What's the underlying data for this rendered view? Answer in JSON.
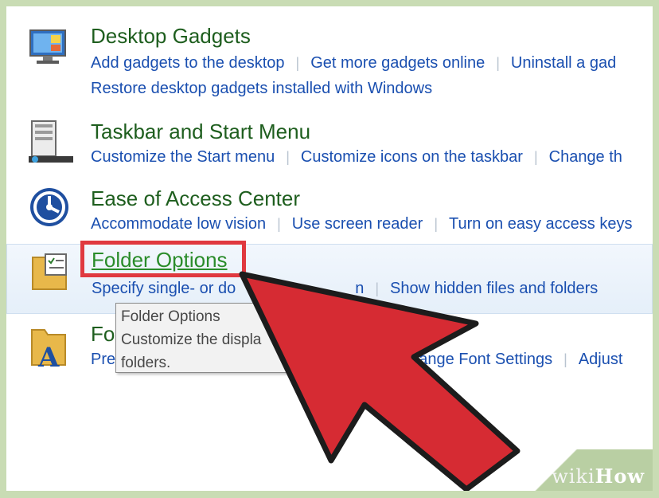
{
  "sections": {
    "gadgets": {
      "title": "Desktop Gadgets",
      "links": [
        "Add gadgets to the desktop",
        "Get more gadgets online",
        "Uninstall a gad"
      ],
      "links2": [
        "Restore desktop gadgets installed with Windows"
      ]
    },
    "taskbar": {
      "title": "Taskbar and Start Menu",
      "links": [
        "Customize the Start menu",
        "Customize icons on the taskbar",
        "Change th"
      ]
    },
    "ease": {
      "title": "Ease of Access Center",
      "links": [
        "Accommodate low vision",
        "Use screen reader",
        "Turn on easy access keys"
      ]
    },
    "folder": {
      "title": "Folder Options",
      "links": [
        "Specify single- or do",
        "n",
        "Show hidden files and folders"
      ]
    },
    "fonts": {
      "title": "Fo",
      "links": [
        "Pre",
        "hange Font Settings",
        "Adjust"
      ]
    }
  },
  "tooltip": {
    "line1": "Folder Options",
    "line2": "Customize the displa",
    "line3": "folders."
  },
  "watermark": {
    "wiki": "wiki",
    "how": "How"
  },
  "colors": {
    "title_green": "#1e5e1e",
    "link_blue": "#1a4fb0",
    "highlight_red": "#e0393f",
    "arrow_red": "#d62b33"
  }
}
